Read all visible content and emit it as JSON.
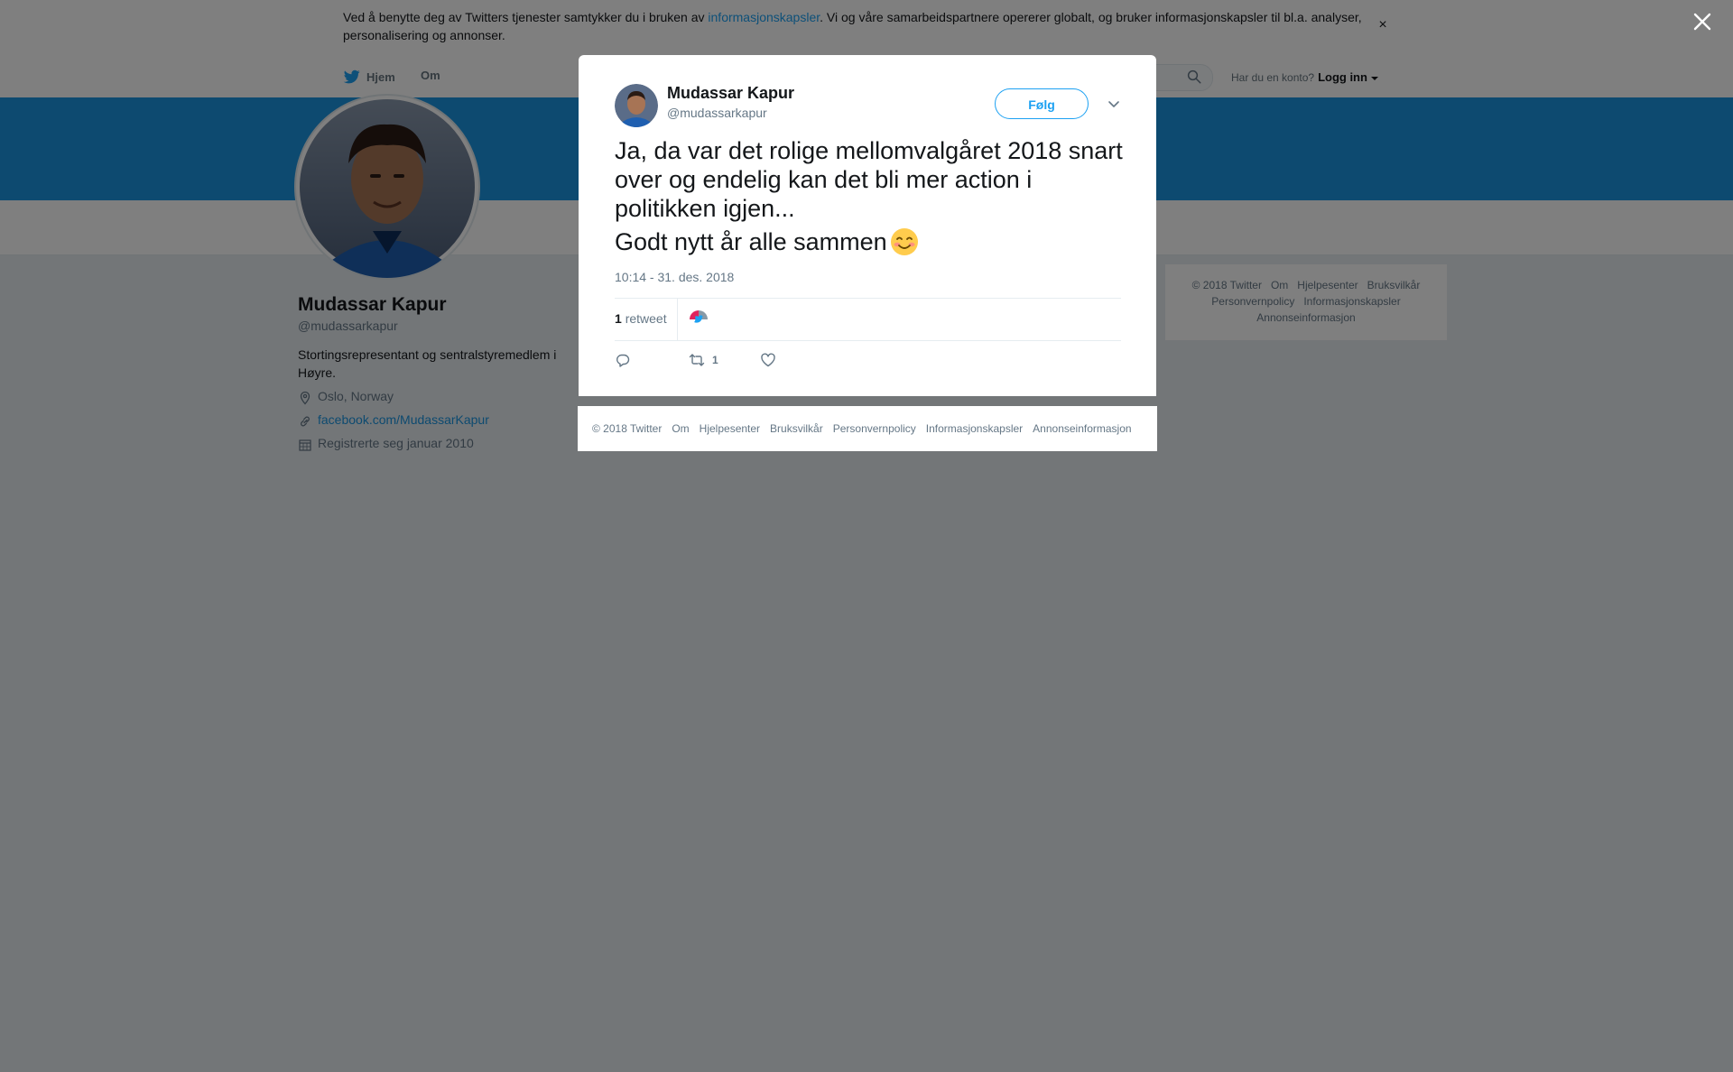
{
  "cookie_bar": {
    "text_before": "Ved å benytte deg av Twitters tjenester samtykker du i bruken av ",
    "link": "informasjonskapsler",
    "text_after": ". Vi og våre samarbeidspartnere opererer globalt, og bruker informasjonskapsler til bl.a. analyser, personalisering og annonser.",
    "close_symbol": "×"
  },
  "topnav": {
    "home": "Hjem",
    "about": "Om",
    "have_account": "Har du en konto?",
    "login": "Logg inn"
  },
  "profile": {
    "name": "Mudassar Kapur",
    "handle": "@mudassarkapur",
    "bio": "Stortingsrepresentant og sentralstyremedlem i Høyre.",
    "location": "Oslo, Norway",
    "url": "facebook.com/MudassarKapur",
    "joined": "Registrerte seg januar 2010"
  },
  "side_footer": {
    "items": [
      "© 2018 Twitter",
      "Om",
      "Hjelpesenter",
      "Bruksvilkår",
      "Personvernpolicy",
      "Informasjonskapsler",
      "Annonseinformasjon"
    ]
  },
  "tweet": {
    "author_name": "Mudassar Kapur",
    "author_handle": "@mudassarkapur",
    "follow_label": "Følg",
    "text_line1": "Ja, da var det rolige mellomvalgåret 2018 snart over og endelig kan det bli mer action i politikken igjen...",
    "text_line2": "Godt nytt år alle sammen",
    "timestamp": "10:14 - 31. des. 2018",
    "retweet_count": "1",
    "retweet_label": "retweet",
    "action_retweet_count": "1"
  },
  "modal_footer": {
    "items": [
      "© 2018 Twitter",
      "Om",
      "Hjelpesenter",
      "Bruksvilkår",
      "Personvernpolicy",
      "Informasjonskapsler",
      "Annonseinformasjon"
    ]
  },
  "colors": {
    "brand_blue": "#1da1f2",
    "banner_blue": "#1b95e0",
    "text_dark": "#14171a",
    "text_muted": "#657786"
  },
  "icons": [
    "twitter-bird-icon",
    "search-icon",
    "location-icon",
    "link-icon",
    "calendar-icon",
    "close-icon",
    "chevron-down-icon",
    "reply-icon",
    "retweet-icon",
    "like-icon",
    "smiling-face-emoji"
  ]
}
